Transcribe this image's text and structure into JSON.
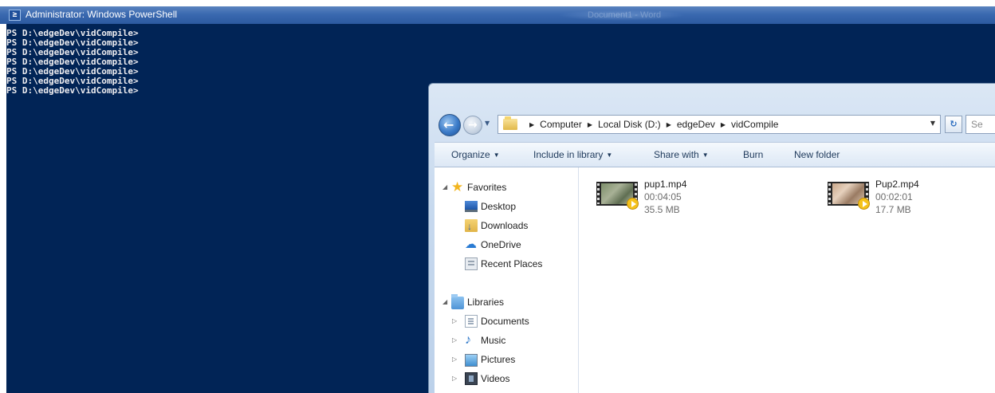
{
  "powershell": {
    "title": "Administrator: Windows PowerShell",
    "icon": "powershell-icon",
    "background_title_text": "Document1 - Word",
    "console_lines": [
      "PS D:\\edgeDev\\vidCompile>",
      "PS D:\\edgeDev\\vidCompile>",
      "PS D:\\edgeDev\\vidCompile>",
      "PS D:\\edgeDev\\vidCompile>",
      "PS D:\\edgeDev\\vidCompile>",
      "PS D:\\edgeDev\\vidCompile>",
      "PS D:\\edgeDev\\vidCompile>"
    ],
    "colors": {
      "console_bg": "#012456",
      "console_text": "#eeedf0"
    }
  },
  "explorer": {
    "address_bar": {
      "breadcrumbs": [
        "Computer",
        "Local Disk (D:)",
        "edgeDev",
        "vidCompile"
      ]
    },
    "search_placeholder": "Se",
    "command_bar": {
      "organize": "Organize",
      "include_in_library": "Include in library",
      "share_with": "Share with",
      "burn": "Burn",
      "new_folder": "New folder"
    },
    "nav_pane": {
      "favorites": {
        "label": "Favorites",
        "items": [
          "Desktop",
          "Downloads",
          "OneDrive",
          "Recent Places"
        ]
      },
      "libraries": {
        "label": "Libraries",
        "items": [
          "Documents",
          "Music",
          "Pictures",
          "Videos"
        ]
      }
    },
    "files": [
      {
        "name": "pup1.mp4",
        "duration": "00:04:05",
        "size": "35.5 MB"
      },
      {
        "name": "Pup2.mp4",
        "duration": "00:02:01",
        "size": "17.7 MB"
      }
    ]
  }
}
